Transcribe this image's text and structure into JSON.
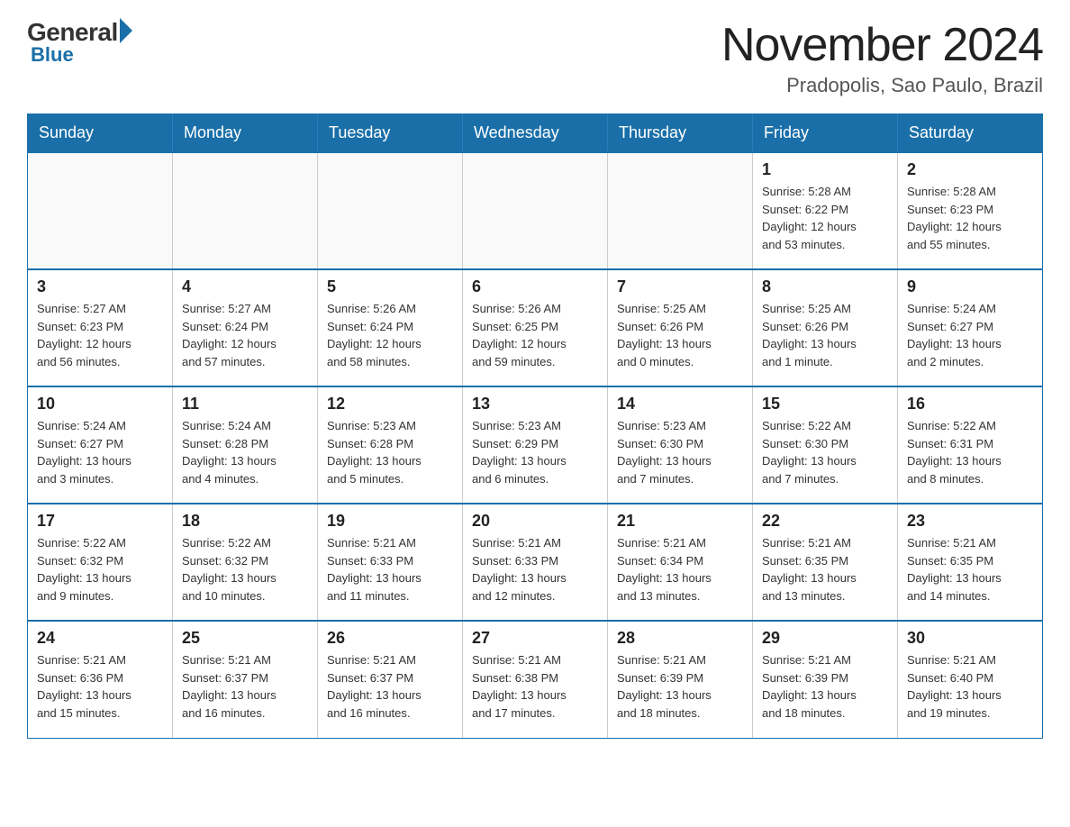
{
  "header": {
    "logo": {
      "general": "General",
      "blue": "Blue"
    },
    "title": "November 2024",
    "subtitle": "Pradopolis, Sao Paulo, Brazil"
  },
  "days_of_week": [
    "Sunday",
    "Monday",
    "Tuesday",
    "Wednesday",
    "Thursday",
    "Friday",
    "Saturday"
  ],
  "weeks": [
    [
      {
        "day": "",
        "info": ""
      },
      {
        "day": "",
        "info": ""
      },
      {
        "day": "",
        "info": ""
      },
      {
        "day": "",
        "info": ""
      },
      {
        "day": "",
        "info": ""
      },
      {
        "day": "1",
        "info": "Sunrise: 5:28 AM\nSunset: 6:22 PM\nDaylight: 12 hours\nand 53 minutes."
      },
      {
        "day": "2",
        "info": "Sunrise: 5:28 AM\nSunset: 6:23 PM\nDaylight: 12 hours\nand 55 minutes."
      }
    ],
    [
      {
        "day": "3",
        "info": "Sunrise: 5:27 AM\nSunset: 6:23 PM\nDaylight: 12 hours\nand 56 minutes."
      },
      {
        "day": "4",
        "info": "Sunrise: 5:27 AM\nSunset: 6:24 PM\nDaylight: 12 hours\nand 57 minutes."
      },
      {
        "day": "5",
        "info": "Sunrise: 5:26 AM\nSunset: 6:24 PM\nDaylight: 12 hours\nand 58 minutes."
      },
      {
        "day": "6",
        "info": "Sunrise: 5:26 AM\nSunset: 6:25 PM\nDaylight: 12 hours\nand 59 minutes."
      },
      {
        "day": "7",
        "info": "Sunrise: 5:25 AM\nSunset: 6:26 PM\nDaylight: 13 hours\nand 0 minutes."
      },
      {
        "day": "8",
        "info": "Sunrise: 5:25 AM\nSunset: 6:26 PM\nDaylight: 13 hours\nand 1 minute."
      },
      {
        "day": "9",
        "info": "Sunrise: 5:24 AM\nSunset: 6:27 PM\nDaylight: 13 hours\nand 2 minutes."
      }
    ],
    [
      {
        "day": "10",
        "info": "Sunrise: 5:24 AM\nSunset: 6:27 PM\nDaylight: 13 hours\nand 3 minutes."
      },
      {
        "day": "11",
        "info": "Sunrise: 5:24 AM\nSunset: 6:28 PM\nDaylight: 13 hours\nand 4 minutes."
      },
      {
        "day": "12",
        "info": "Sunrise: 5:23 AM\nSunset: 6:28 PM\nDaylight: 13 hours\nand 5 minutes."
      },
      {
        "day": "13",
        "info": "Sunrise: 5:23 AM\nSunset: 6:29 PM\nDaylight: 13 hours\nand 6 minutes."
      },
      {
        "day": "14",
        "info": "Sunrise: 5:23 AM\nSunset: 6:30 PM\nDaylight: 13 hours\nand 7 minutes."
      },
      {
        "day": "15",
        "info": "Sunrise: 5:22 AM\nSunset: 6:30 PM\nDaylight: 13 hours\nand 7 minutes."
      },
      {
        "day": "16",
        "info": "Sunrise: 5:22 AM\nSunset: 6:31 PM\nDaylight: 13 hours\nand 8 minutes."
      }
    ],
    [
      {
        "day": "17",
        "info": "Sunrise: 5:22 AM\nSunset: 6:32 PM\nDaylight: 13 hours\nand 9 minutes."
      },
      {
        "day": "18",
        "info": "Sunrise: 5:22 AM\nSunset: 6:32 PM\nDaylight: 13 hours\nand 10 minutes."
      },
      {
        "day": "19",
        "info": "Sunrise: 5:21 AM\nSunset: 6:33 PM\nDaylight: 13 hours\nand 11 minutes."
      },
      {
        "day": "20",
        "info": "Sunrise: 5:21 AM\nSunset: 6:33 PM\nDaylight: 13 hours\nand 12 minutes."
      },
      {
        "day": "21",
        "info": "Sunrise: 5:21 AM\nSunset: 6:34 PM\nDaylight: 13 hours\nand 13 minutes."
      },
      {
        "day": "22",
        "info": "Sunrise: 5:21 AM\nSunset: 6:35 PM\nDaylight: 13 hours\nand 13 minutes."
      },
      {
        "day": "23",
        "info": "Sunrise: 5:21 AM\nSunset: 6:35 PM\nDaylight: 13 hours\nand 14 minutes."
      }
    ],
    [
      {
        "day": "24",
        "info": "Sunrise: 5:21 AM\nSunset: 6:36 PM\nDaylight: 13 hours\nand 15 minutes."
      },
      {
        "day": "25",
        "info": "Sunrise: 5:21 AM\nSunset: 6:37 PM\nDaylight: 13 hours\nand 16 minutes."
      },
      {
        "day": "26",
        "info": "Sunrise: 5:21 AM\nSunset: 6:37 PM\nDaylight: 13 hours\nand 16 minutes."
      },
      {
        "day": "27",
        "info": "Sunrise: 5:21 AM\nSunset: 6:38 PM\nDaylight: 13 hours\nand 17 minutes."
      },
      {
        "day": "28",
        "info": "Sunrise: 5:21 AM\nSunset: 6:39 PM\nDaylight: 13 hours\nand 18 minutes."
      },
      {
        "day": "29",
        "info": "Sunrise: 5:21 AM\nSunset: 6:39 PM\nDaylight: 13 hours\nand 18 minutes."
      },
      {
        "day": "30",
        "info": "Sunrise: 5:21 AM\nSunset: 6:40 PM\nDaylight: 13 hours\nand 19 minutes."
      }
    ]
  ]
}
